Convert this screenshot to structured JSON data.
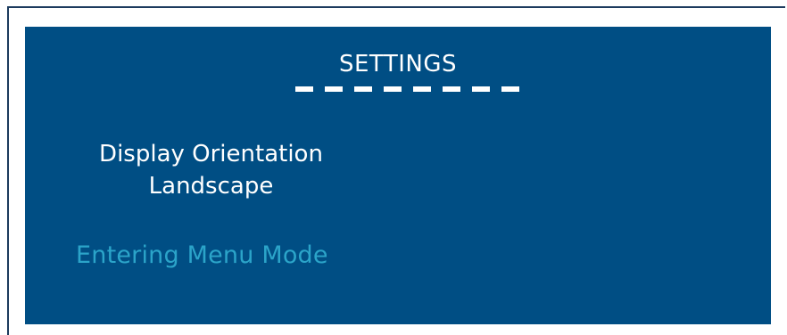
{
  "screen": {
    "title": "SETTINGS",
    "indicator_dashes": 8,
    "setting_name": "Display Orientation",
    "setting_value": "Landscape",
    "status_text": "Entering Menu Mode"
  },
  "colors": {
    "screen_background": "#004e84",
    "text_primary": "#ffffff",
    "status_text": "#2ba4c9",
    "frame_border": "#1d3b5e"
  }
}
